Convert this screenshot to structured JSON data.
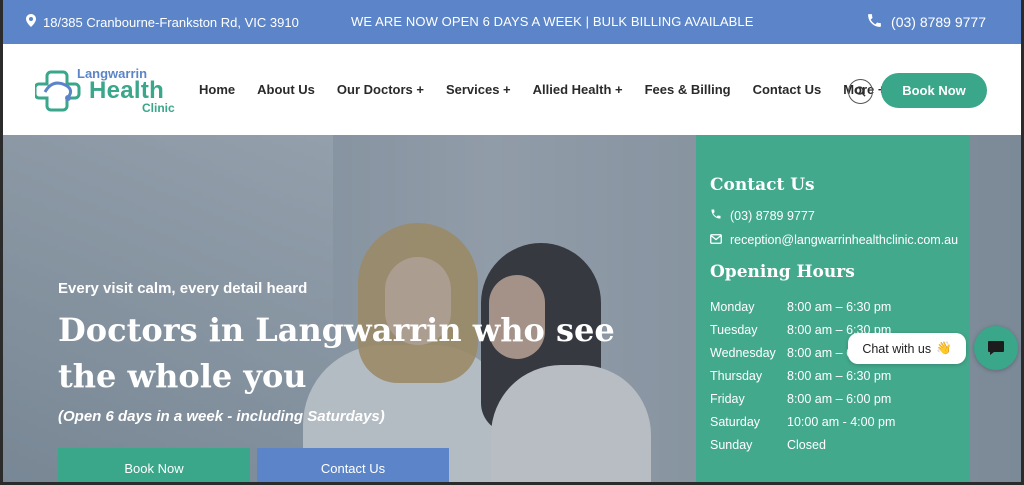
{
  "topbar": {
    "address": "18/385 Cranbourne-Frankston Rd, VIC 3910",
    "promo": "WE ARE NOW OPEN 6 DAYS A WEEK | BULK BILLING AVAILABLE",
    "phone": "(03) 8789 9777"
  },
  "logo": {
    "line1": "Langwarrin",
    "line2": "Health",
    "line3": "Clinic"
  },
  "nav": {
    "items": [
      "Home",
      "About Us",
      "Our Doctors +",
      "Services +",
      "Allied Health +",
      "Fees & Billing",
      "Contact Us",
      "More +"
    ],
    "book_label": "Book Now"
  },
  "hero": {
    "tagline": "Every visit calm, every detail heard",
    "title": "Doctors in Langwarrin who see the whole you",
    "hours_note": "(Open 6 days in a week - including Saturdays)",
    "book_label": "Book Now",
    "contact_label": "Contact Us"
  },
  "panel": {
    "contact_heading": "Contact Us",
    "phone": "(03) 8789 9777",
    "email": "reception@langwarrinhealthclinic.com.au",
    "hours_heading": "Opening Hours",
    "hours": [
      {
        "day": "Monday",
        "time": "8:00 am – 6:30 pm"
      },
      {
        "day": "Tuesday",
        "time": "8:00 am – 6:30 pm"
      },
      {
        "day": "Wednesday",
        "time": "8:00 am – 6:30 pm"
      },
      {
        "day": "Thursday",
        "time": "8:00 am – 6:30 pm"
      },
      {
        "day": "Friday",
        "time": "8:00 am – 6:00 pm"
      },
      {
        "day": "Saturday",
        "time": "10:00 am - 4:00 pm"
      },
      {
        "day": "Sunday",
        "time": "Closed"
      }
    ]
  },
  "chat": {
    "label": "Chat with us",
    "emoji": "👋"
  },
  "colors": {
    "topbar": "#5b85c8",
    "accent_green": "#3aa68a",
    "panel_green": "#43a98c",
    "accent_blue": "#5b85c8"
  },
  "icons": {
    "address": "map-pin-icon",
    "phone": "phone-icon",
    "email": "envelope-icon",
    "search": "search-icon",
    "chat": "chat-bubble-icon"
  }
}
